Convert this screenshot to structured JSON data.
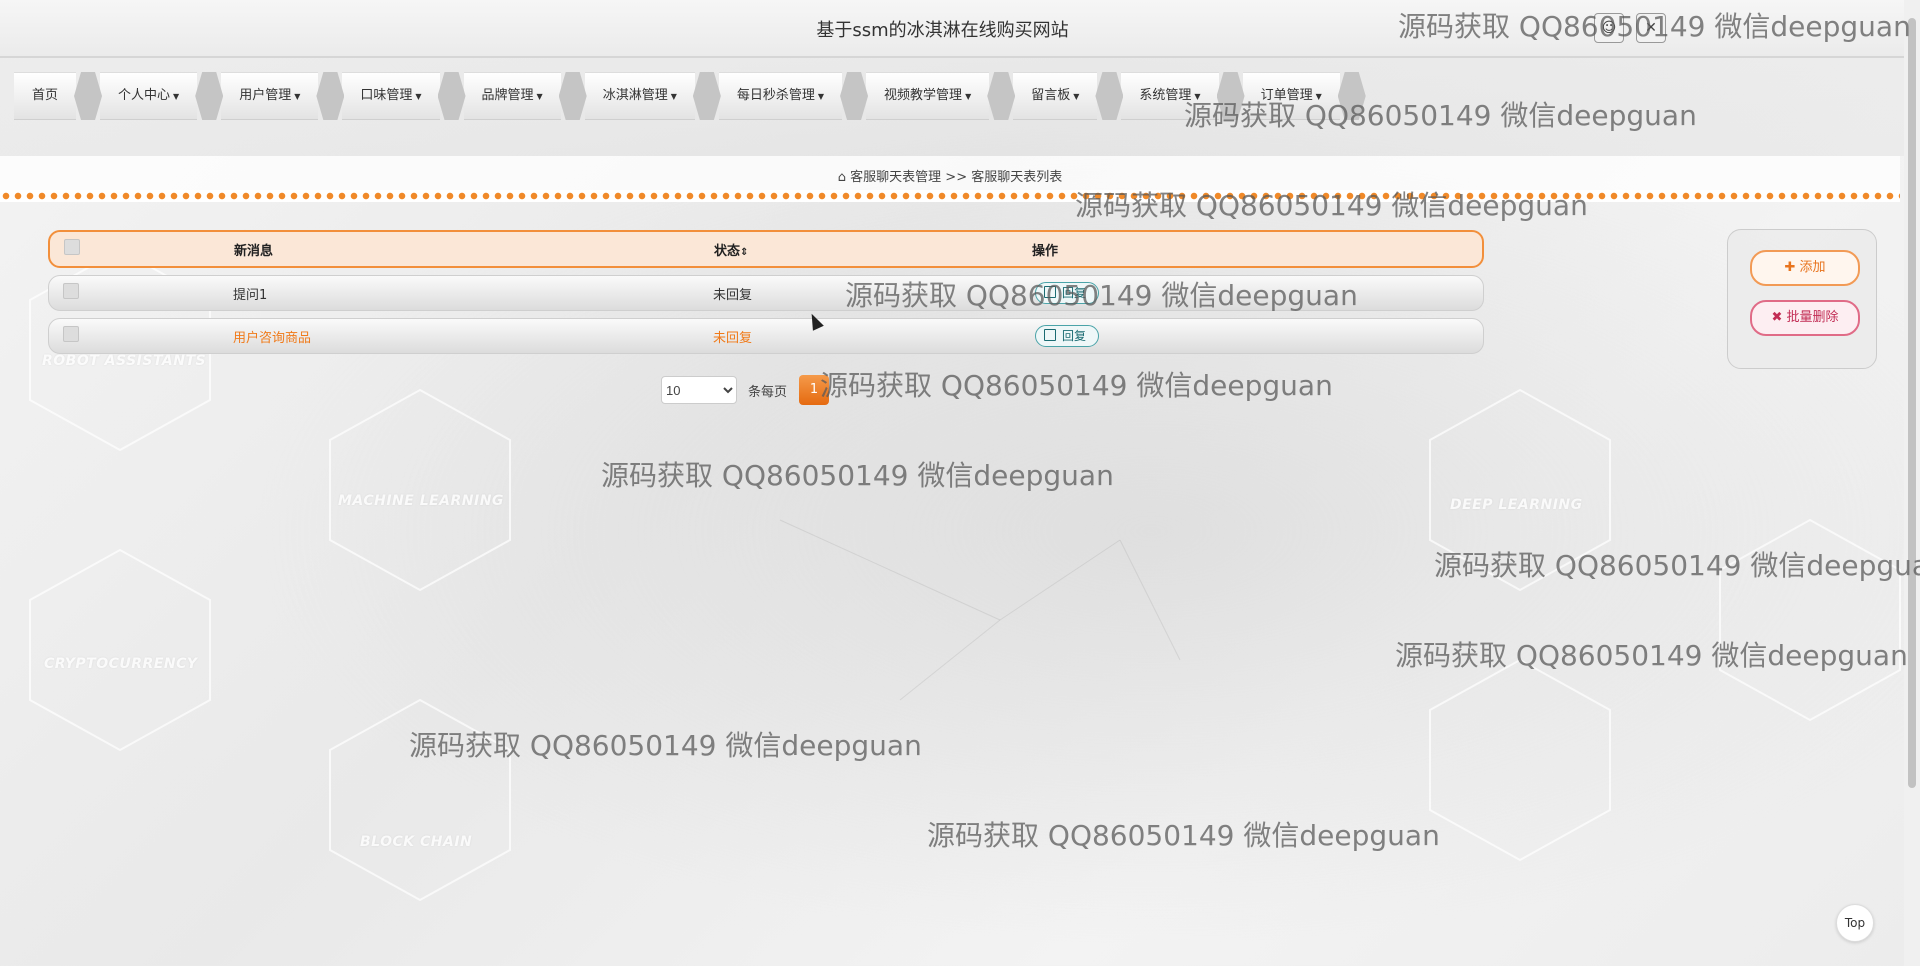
{
  "header": {
    "title": "基于ssm的冰淇淋在线购买网站"
  },
  "nav": {
    "items": [
      "首页",
      "个人中心",
      "用户管理",
      "口味管理",
      "品牌管理",
      "冰淇淋管理",
      "每日秒杀管理",
      "视频教学管理",
      "留言板",
      "系统管理",
      "订单管理"
    ],
    "has_dropdown": [
      false,
      true,
      true,
      true,
      true,
      true,
      true,
      true,
      true,
      true,
      true
    ]
  },
  "breadcrumb": {
    "section": "客服聊天表管理",
    "separator": ">>",
    "page": "客服聊天表列表"
  },
  "table": {
    "columns": {
      "message": "新消息",
      "status": "状态",
      "action": "操作"
    },
    "rows": [
      {
        "message": "提问1",
        "status": "未回复",
        "action": "回复",
        "highlight": false
      },
      {
        "message": "用户咨询商品",
        "status": "未回复",
        "action": "回复",
        "highlight": true
      }
    ]
  },
  "pagination": {
    "page_size": "10",
    "page_size_options": [
      "10"
    ],
    "per_page_label": "条每页",
    "current_page": "1"
  },
  "actions": {
    "add": "添加",
    "batch_delete": "批量删除"
  },
  "top_button": "Top",
  "bg_labels": [
    "ROBOT ASSISTANTS",
    "MACHINE LEARNING",
    "CRYPTOCURRENCY",
    "BLOCK CHAIN",
    "DEEP LEARNING"
  ],
  "watermark": "源码获取 QQ86050149 微信deepguan",
  "colors": {
    "accent": "#f07a19",
    "reply": "#1a6b72",
    "delete": "#c22d55"
  }
}
